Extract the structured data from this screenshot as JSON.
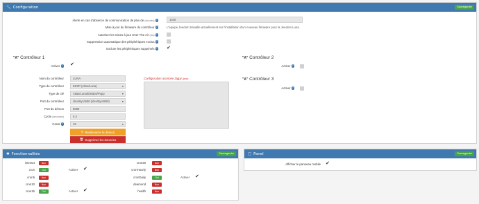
{
  "config": {
    "title": "Configuration",
    "save": "Sauvegarder",
    "alert_label": "Alerte en cas d'absence de communication de plus de",
    "alert_unit": "(minutes)",
    "alert_value": "1440",
    "firmware_label": "Mise à jour du firmware du contrôleur",
    "firmware_text": "L'équipe Jeedom travaille actuellement sur l'installation d'un nouveau firmware pour la Jeedom Luna.",
    "ota_label": "Autoriser les mises à jour Over The Air",
    "ota_unit": "(ota)",
    "autodel_label": "Suppression automatique des périphériques exclus",
    "exclude_label": "Exclure les périphériques supprimés"
  },
  "ctrl1": {
    "title": "Contrôleur 1",
    "active_label": "Activer",
    "name_label": "Nom du contrôleur",
    "name_value": "LUNA",
    "type_label": "Type de contrôleur",
    "type_value": "EZSP (Atlas/Luna)",
    "key_label": "Type de clé",
    "key_value": "Atlas/Luna/Elelabs/Popp",
    "port_label": "Port du contrôleur",
    "port_value": "/dev/ttyUSB0 (/dev/ttyUSB0)",
    "daemon_port_label": "Port du démon",
    "daemon_port_value": "8089",
    "cycle_label": "Cycle",
    "cycle_unit": "(secondes)",
    "cycle_value": "0.3",
    "channel_label": "Canal",
    "channel_value": "15",
    "advanced_label": "Configuration avancée Zigpy",
    "advanced_unit": "(json)",
    "restart_btn": "Redémarrer le démon",
    "delete_btn": "Supprimer les données"
  },
  "ctrl2": {
    "title": "Contrôleur 2",
    "active_label": "Activer"
  },
  "ctrl3": {
    "title": "Contrôleur 3",
    "active_label": "Activer"
  },
  "func": {
    "title": "Fonctionnalités",
    "save": "Sauvegarder",
    "rows_left": [
      {
        "name": "interact",
        "state": "Non"
      },
      {
        "name": "cron",
        "state": "Oui",
        "active": "Activer"
      },
      {
        "name": "cron5",
        "state": "Non"
      },
      {
        "name": "cron10",
        "state": "Non"
      },
      {
        "name": "cron15",
        "state": "Oui",
        "active": "Activer"
      }
    ],
    "rows_right": [
      {
        "name": "cron30",
        "state": "Non"
      },
      {
        "name": "cronHourly",
        "state": "Non"
      },
      {
        "name": "cronDaily",
        "state": "Oui",
        "active": "Activer"
      },
      {
        "name": "deamond",
        "state": "Non"
      },
      {
        "name": "health",
        "state": "Non"
      }
    ]
  },
  "panel": {
    "title": "Panel",
    "save": "Sauvegarder",
    "mobile_label": "Afficher le panneau mobile"
  },
  "colors": {
    "header": "#3f79b0",
    "yes": "#47a447",
    "no": "#c9302c",
    "restart": "#f0a028",
    "delete": "#c9302c"
  }
}
